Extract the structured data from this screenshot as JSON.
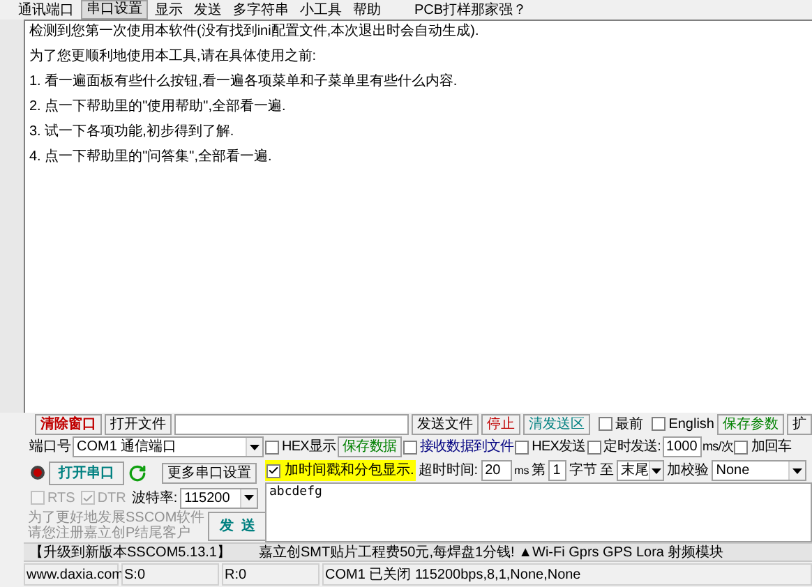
{
  "menu": [
    {
      "label": "通讯端口",
      "selected": false
    },
    {
      "label": "串口设置",
      "selected": true
    },
    {
      "label": "显示",
      "selected": false
    },
    {
      "label": "发送",
      "selected": false
    },
    {
      "label": "多字符串",
      "selected": false
    },
    {
      "label": "小工具",
      "selected": false
    },
    {
      "label": "帮助",
      "selected": false
    },
    {
      "label": "PCB打样那家强？",
      "selected": false
    }
  ],
  "log": [
    "检测到您第一次使用本软件(没有找到ini配置文件,本次退出时会自动生成).",
    "为了您更顺利地使用本工具,请在具体使用之前:",
    "1. 看一遍面板有些什么按钮,看一遍各项菜单和子菜单里有些什么内容.",
    "2. 点一下帮助里的\"使用帮助\",全部看一遍.",
    "3. 试一下各项功能,初步得到了解.",
    "4. 点一下帮助里的\"问答集\",全部看一遍."
  ],
  "toolbar": {
    "clear_button": "清除窗口",
    "open_file_button": "打开文件",
    "send_file_button": "发送文件",
    "stop_button": "停止",
    "clear_send_button": "清发送区",
    "topmost": {
      "label": "最前",
      "checked": false
    },
    "english": {
      "label": "English",
      "checked": false
    },
    "save_params_button": "保存参数",
    "expand_button": "扩"
  },
  "port": {
    "label": "端口号",
    "value": "COM1 通信端口",
    "more_settings_button": "更多串口设置",
    "open_button": "打开串口",
    "open": false,
    "rts": {
      "label": "RTS",
      "checked": false,
      "disabled": true
    },
    "dtr": {
      "label": "DTR",
      "checked": true,
      "disabled": true
    },
    "baud_label": "波特率:",
    "baud": "115200"
  },
  "receive": {
    "hex_display": {
      "label": "HEX显示",
      "checked": false
    },
    "save_data_button": "保存数据",
    "to_file": {
      "label": "接收数据到文件",
      "checked": false
    },
    "timestamp": {
      "label": "加时间戳和分包显示.",
      "checked": true
    },
    "timeout_label": "超时时间:",
    "timeout": "20",
    "timeout_unit": "ms"
  },
  "send": {
    "hex_send": {
      "label": "HEX发送",
      "checked": false
    },
    "timed": {
      "label": "定时发送:",
      "checked": false
    },
    "interval": "1000",
    "interval_unit": "ms/次",
    "add_crlf": {
      "label": "加回车",
      "checked": false
    },
    "from_label": "第",
    "from": "1",
    "bytes_label": "字节",
    "to_label": "至",
    "to": "末尾",
    "checksum_label": "加校验",
    "checksum": "None",
    "text": "abcdefg",
    "send_button": "发  送"
  },
  "notice": [
    "为了更好地发展SSCOM软件",
    "请您注册嘉立创P结尾客户"
  ],
  "marquee": [
    "【升级到新版本SSCOM5.13.1】",
    "嘉立创SMT贴片工程费50元,每焊盘1分钱! ▲Wi-Fi Gprs GPS Lora 射频模块"
  ],
  "status_bar": [
    "www.daxia.com",
    "S:0",
    "R:0",
    "COM1 已关闭  115200bps,8,1,None,None"
  ]
}
